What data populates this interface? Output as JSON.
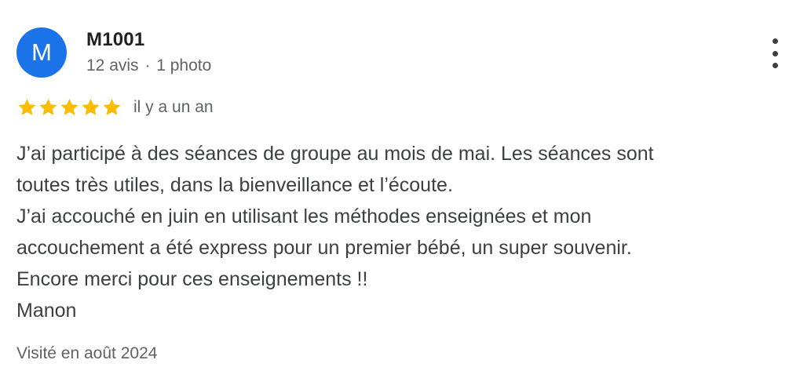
{
  "review": {
    "author": {
      "initial": "M",
      "name": "M1001",
      "review_count": "12 avis",
      "separator": "·",
      "photo_count": "1 photo",
      "avatar_color": "#1a73e8"
    },
    "more_icon": "more-vert-icon",
    "rating": {
      "stars": 5,
      "max": 5,
      "star_icon": "star-icon",
      "star_color": "#fbbc04"
    },
    "date": "il y a un an",
    "text_lines": [
      "J’ai participé à des séances de groupe au mois de mai. Les séances sont",
      "toutes très utiles, dans la bienveillance et l’écoute.",
      "J’ai accouché en juin en utilisant les méthodes enseignées et mon",
      "accouchement a été express pour un premier bébé, un super souvenir.",
      "Encore merci pour ces enseignements !!",
      "Manon"
    ],
    "visited": "Visité en août 2024"
  }
}
